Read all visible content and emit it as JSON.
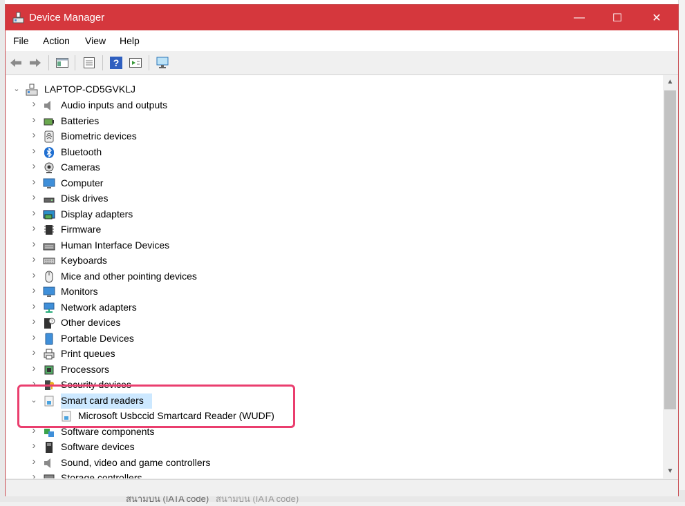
{
  "window": {
    "title": "Device Manager",
    "minimize_glyph": "—",
    "maximize_glyph": "☐",
    "close_glyph": "✕"
  },
  "menu": {
    "items": [
      "File",
      "Action",
      "View",
      "Help"
    ]
  },
  "toolbar": {
    "buttons": [
      "back-arrow-icon",
      "forward-arrow-icon",
      "show-hide-console-tree-icon",
      "properties-icon",
      "help-icon",
      "run-icon",
      "scan-hardware-icon"
    ]
  },
  "tree": {
    "root": "LAPTOP-CD5GVKLJ",
    "categories": [
      {
        "label": "Audio inputs and outputs",
        "icon": "speaker-icon"
      },
      {
        "label": "Batteries",
        "icon": "battery-icon"
      },
      {
        "label": "Biometric devices",
        "icon": "fingerprint-icon"
      },
      {
        "label": "Bluetooth",
        "icon": "bluetooth-icon"
      },
      {
        "label": "Cameras",
        "icon": "camera-icon"
      },
      {
        "label": "Computer",
        "icon": "computer-icon"
      },
      {
        "label": "Disk drives",
        "icon": "disk-drive-icon"
      },
      {
        "label": "Display adapters",
        "icon": "display-adapter-icon"
      },
      {
        "label": "Firmware",
        "icon": "firmware-icon"
      },
      {
        "label": "Human Interface Devices",
        "icon": "hid-icon"
      },
      {
        "label": "Keyboards",
        "icon": "keyboard-icon"
      },
      {
        "label": "Mice and other pointing devices",
        "icon": "mouse-icon"
      },
      {
        "label": "Monitors",
        "icon": "monitor-icon"
      },
      {
        "label": "Network adapters",
        "icon": "network-icon"
      },
      {
        "label": "Other devices",
        "icon": "other-device-icon"
      },
      {
        "label": "Portable Devices",
        "icon": "portable-device-icon"
      },
      {
        "label": "Print queues",
        "icon": "printer-icon"
      },
      {
        "label": "Processors",
        "icon": "processor-icon"
      },
      {
        "label": "Security devices",
        "icon": "security-device-icon"
      },
      {
        "label": "Smart card readers",
        "icon": "smart-card-reader-icon",
        "expanded": true,
        "selected": true
      },
      {
        "label": "Software components",
        "icon": "software-component-icon"
      },
      {
        "label": "Software devices",
        "icon": "software-device-icon"
      },
      {
        "label": "Sound, video and game controllers",
        "icon": "sound-icon"
      },
      {
        "label": "Storage controllers",
        "icon": "storage-controller-icon"
      }
    ],
    "smart_card_child": "Microsoft Usbccid Smartcard Reader (WUDF)"
  },
  "background": {
    "bottom_text_1": "สนามบิน (IATA code)",
    "bottom_text_2": "สนามบิน (IATA code)"
  },
  "colors": {
    "titlebar": "#d5373d",
    "selection": "#cce8ff",
    "annotation_box": "#ea3e6e"
  }
}
